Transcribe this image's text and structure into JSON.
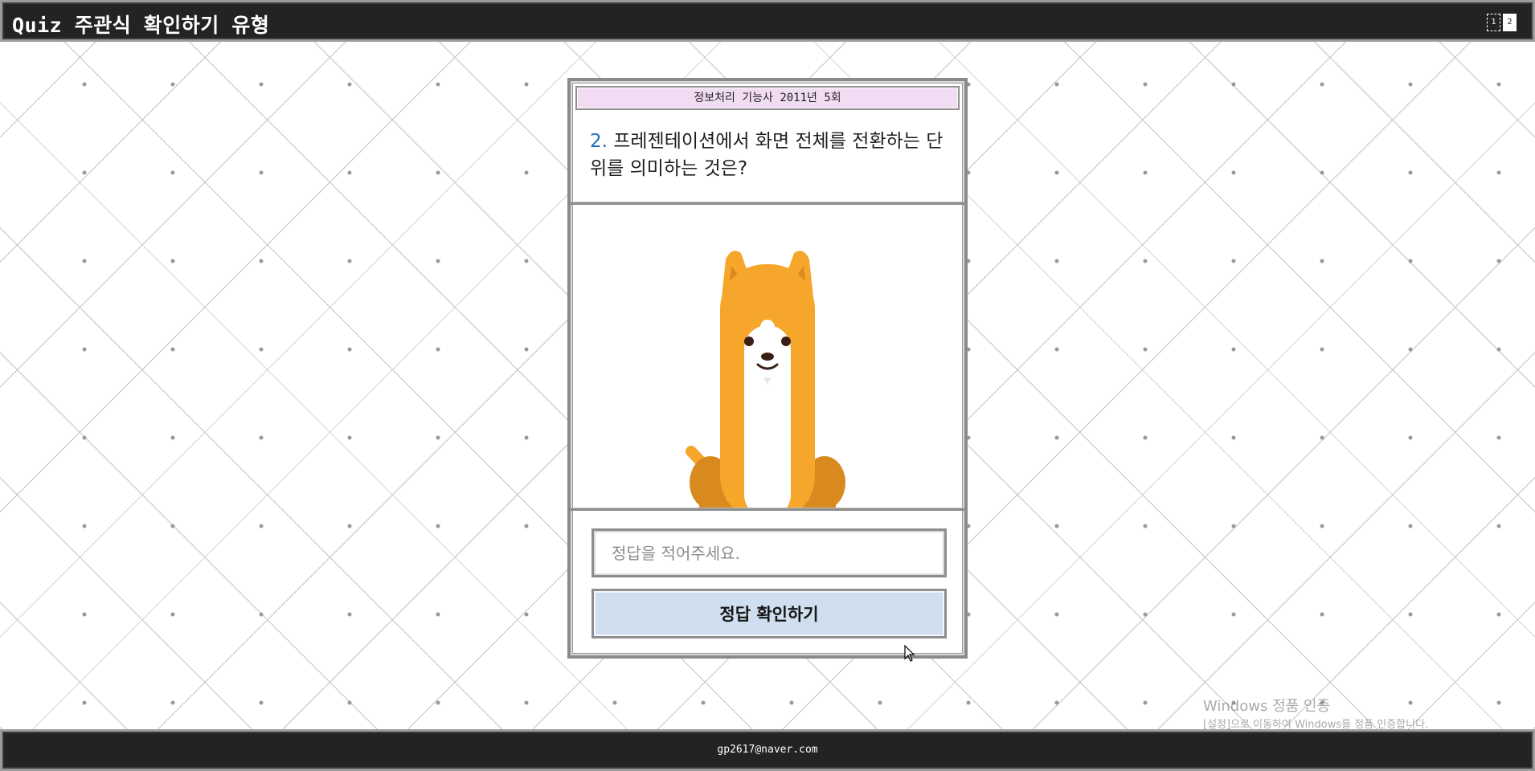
{
  "app": {
    "title": "Quiz 주관식 확인하기 유형",
    "window_controls": [
      "1",
      "2"
    ]
  },
  "quiz": {
    "header": "정보처리 기능사 2011년 5회",
    "question_number": "2.",
    "question_text": "프레젠테이션에서 화면 전체를 전환하는 단위를 의미하는 것은?",
    "illustration_icon": "corgi-dog-illustration",
    "answer_placeholder": "정답을 적어주세요.",
    "answer_value": "",
    "check_button_label": "정답 확인하기"
  },
  "watermark": {
    "title": "Windows 정품 인증",
    "subtitle": "[설정]으로 이동하여 Windows를 정품 인증합니다."
  },
  "footer": {
    "email": "gp2617@naver.com"
  },
  "colors": {
    "bar_background": "#232323",
    "card_header_background": "#f1dcf3",
    "button_background": "#cfdff0",
    "question_number_color": "#1d6fbf",
    "dog_orange": "#f5a62b",
    "dog_dark_orange": "#d98a1f"
  }
}
